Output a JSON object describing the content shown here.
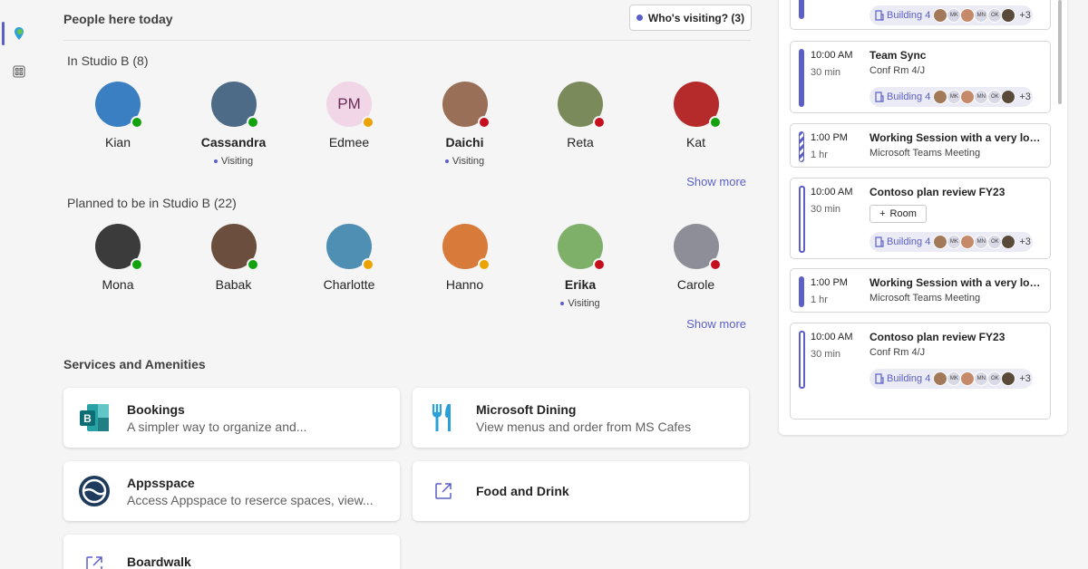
{
  "header": {
    "title": "People here today",
    "visiting_button": "Who's visiting? (3)"
  },
  "groups": [
    {
      "title": "In Studio B (8)",
      "show_more": "Show more",
      "people": [
        {
          "name": "Kian",
          "bold": false,
          "status": "available",
          "visiting": "",
          "color": "#3a7fc2"
        },
        {
          "name": "Cassandra",
          "bold": true,
          "status": "available",
          "visiting": "Visiting",
          "color": "#4d6a86"
        },
        {
          "name": "Edmee",
          "bold": false,
          "status": "away",
          "visiting": "",
          "initials": "PM",
          "color": "#f0d6e6"
        },
        {
          "name": "Daichi",
          "bold": true,
          "status": "busy",
          "visiting": "Visiting",
          "color": "#9a6f58"
        },
        {
          "name": "Reta",
          "bold": false,
          "status": "dnd",
          "visiting": "",
          "color": "#7a8a5a"
        },
        {
          "name": "Kat",
          "bold": false,
          "status": "available",
          "visiting": "",
          "color": "#b52b2b"
        }
      ]
    },
    {
      "title": "Planned to be in Studio B (22)",
      "show_more": "Show more",
      "people": [
        {
          "name": "Mona",
          "bold": false,
          "status": "available",
          "visiting": "",
          "color": "#3b3b3b"
        },
        {
          "name": "Babak",
          "bold": false,
          "status": "available",
          "visiting": "",
          "color": "#6b4e3d"
        },
        {
          "name": "Charlotte",
          "bold": false,
          "status": "away",
          "visiting": "",
          "color": "#4f8fb3"
        },
        {
          "name": "Hanno",
          "bold": false,
          "status": "away",
          "visiting": "",
          "color": "#d87a3a"
        },
        {
          "name": "Erika",
          "bold": true,
          "status": "busy",
          "visiting": "Visiting",
          "color": "#7fb06a"
        },
        {
          "name": "Carole",
          "bold": false,
          "status": "dnd",
          "visiting": "",
          "color": "#8e8e99"
        }
      ]
    }
  ],
  "services": {
    "title": "Services and Amenities",
    "items": [
      {
        "title": "Bookings",
        "desc": "A simpler way to organize and..."
      },
      {
        "title": "Microsoft Dining",
        "desc": "View menus and order from MS Cafes"
      },
      {
        "title": "Appsspace",
        "desc": "Access Appspace to reserce spaces, view..."
      },
      {
        "title": "Food and Drink",
        "desc": ""
      },
      {
        "title": "Boardwalk",
        "desc": ""
      }
    ]
  },
  "events": [
    {
      "time": "",
      "dur": "",
      "title": "",
      "loc": "",
      "building": "Building 4",
      "more": "+3",
      "bar": "solid"
    },
    {
      "time": "10:00 AM",
      "dur": "30 min",
      "title": "Team Sync",
      "loc": "Conf Rm 4/J",
      "building": "Building 4",
      "more": "+3",
      "bar": "solid"
    },
    {
      "time": "1:00 PM",
      "dur": "1 hr",
      "title": "Working Session with a very lon...",
      "loc": "Microsoft Teams Meeting",
      "bar": "stripe"
    },
    {
      "time": "10:00 AM",
      "dur": "30 min",
      "title": "Contoso plan review FY23",
      "loc": "",
      "room_button": "Room",
      "building": "Building 4",
      "more": "+3",
      "bar": "hollow"
    },
    {
      "time": "1:00 PM",
      "dur": "1 hr",
      "title": "Working Session with a very lon...",
      "loc": "Microsoft Teams Meeting",
      "bar": "solid"
    },
    {
      "time": "10:00 AM",
      "dur": "30 min",
      "title": "Contoso plan review FY23",
      "loc": "Conf Rm 4/J",
      "building": "Building 4",
      "more": "+3",
      "bar": "hollow"
    }
  ],
  "mini_avatars": [
    "",
    "MK",
    "",
    "MN",
    "OK",
    ""
  ]
}
